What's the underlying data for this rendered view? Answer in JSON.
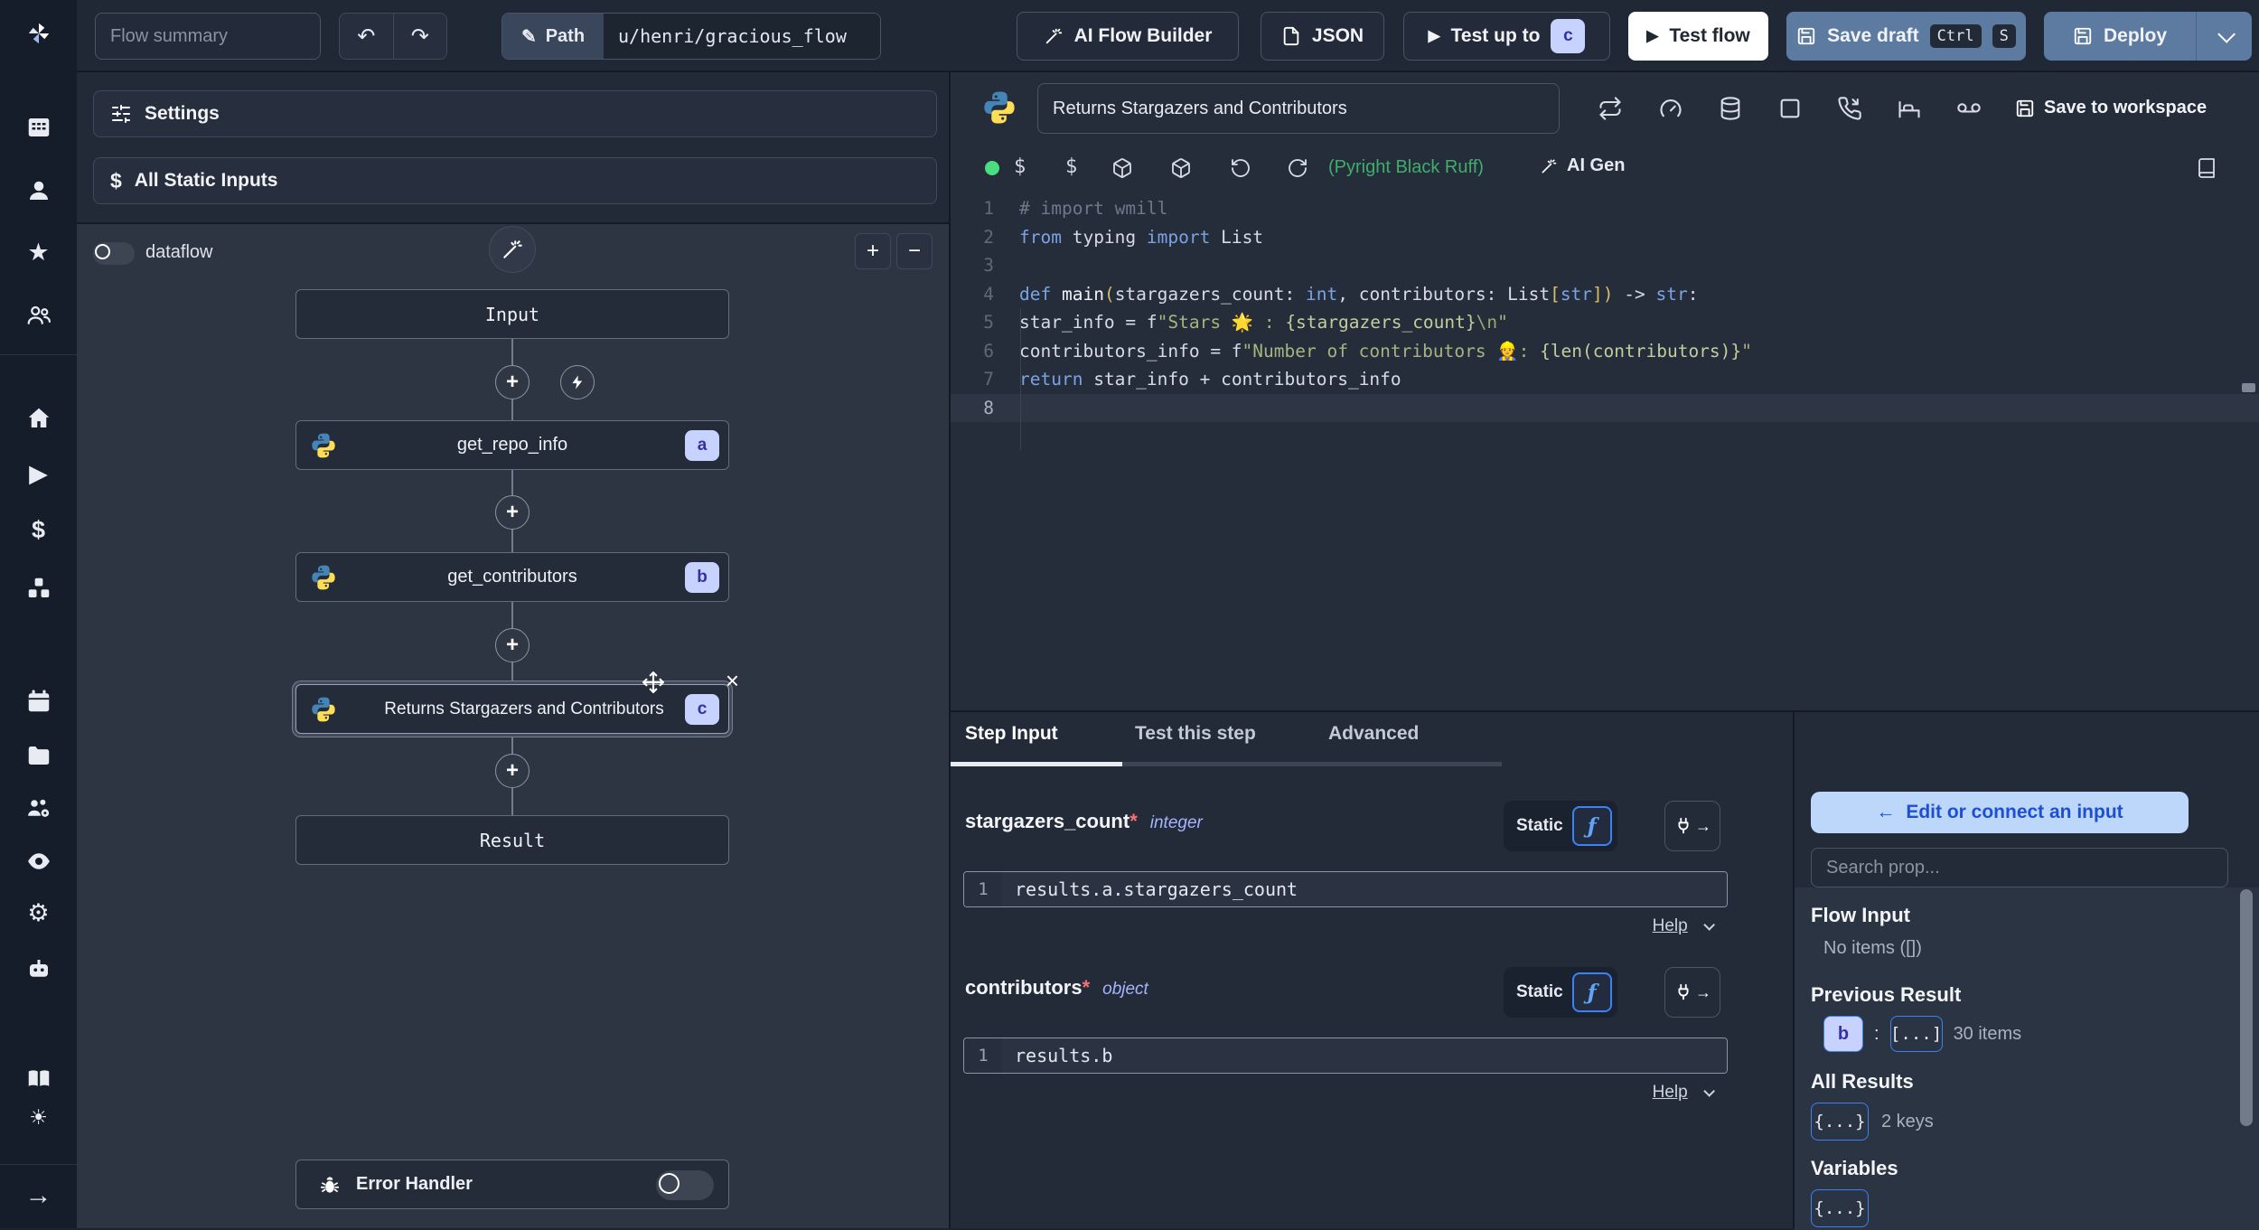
{
  "icons": {
    "undo": "↶",
    "redo": "↷",
    "pencil": "✎",
    "play": "▶",
    "plus": "+",
    "minus": "−",
    "node_plus": "+",
    "close": "×",
    "dollar": "$",
    "star": "★",
    "gear": "⚙",
    "sun": "☀",
    "arrow_right": "→",
    "back_arrow": "←",
    "colon": ":"
  },
  "header": {
    "flow_summary_placeholder": "Flow summary",
    "path_label": "Path",
    "path_value": "u/henri/gracious_flow",
    "ai_flow_builder": "AI Flow Builder",
    "json": "JSON",
    "test_up_to": "Test up to",
    "test_up_to_badge": "c",
    "test_flow": "Test flow",
    "save_draft": "Save draft",
    "save_draft_kbd1": "Ctrl",
    "save_draft_kbd2": "S",
    "deploy": "Deploy"
  },
  "left_panel": {
    "settings": "Settings",
    "all_static_inputs": "All Static Inputs",
    "dataflow": "dataflow",
    "nodes": {
      "input": "Input",
      "a_label": "get_repo_info",
      "a_badge": "a",
      "b_label": "get_contributors",
      "b_badge": "b",
      "c_label": "Returns Stargazers and Contributors",
      "c_badge": "c",
      "result": "Result",
      "error_handler": "Error Handler"
    }
  },
  "editor": {
    "step_name": "Returns Stargazers and Contributors",
    "save_to_workspace": "Save to workspace",
    "lint": "(Pyright Black Ruff)",
    "ai_gen": "AI Gen",
    "code_lines": [
      {
        "tokens": [
          [
            "cmt",
            "# import wmill"
          ]
        ]
      },
      {
        "tokens": [
          [
            "kw",
            "from"
          ],
          [
            "pl",
            " typing "
          ],
          [
            "kw",
            "import"
          ],
          [
            "pl",
            " List"
          ]
        ]
      },
      {
        "tokens": []
      },
      {
        "tokens": [
          [
            "kw",
            "def"
          ],
          [
            "fn",
            " main"
          ],
          [
            "br",
            "("
          ],
          [
            "pl",
            "stargazers_count: "
          ],
          [
            "ty",
            "int"
          ],
          [
            "pl",
            ", contributors: "
          ],
          [
            "pl",
            "List"
          ],
          [
            "br",
            "["
          ],
          [
            "ty",
            "str"
          ],
          [
            "br",
            "]"
          ],
          [
            "br",
            ")"
          ],
          [
            "pl",
            " -> "
          ],
          [
            "ty",
            "str"
          ],
          [
            "pl",
            ":"
          ]
        ]
      },
      {
        "tokens": [
          [
            "pl",
            "    star_info = f"
          ],
          [
            "str",
            "\"Stars 🌟 : "
          ],
          [
            "strb",
            "{stargazers_count}"
          ],
          [
            "esc",
            "\\n"
          ],
          [
            "str",
            "\""
          ]
        ]
      },
      {
        "tokens": [
          [
            "pl",
            "    contributors_info = f"
          ],
          [
            "str",
            "\"Number of contributors 👷: "
          ],
          [
            "strb",
            "{len(contributors)}"
          ],
          [
            "str",
            "\""
          ]
        ]
      },
      {
        "tokens": [
          [
            "pl",
            "    "
          ],
          [
            "kw",
            "return"
          ],
          [
            "pl",
            " star_info + contributors_info"
          ]
        ]
      },
      {
        "tokens": [],
        "active": true
      }
    ]
  },
  "bottom": {
    "tabs": [
      "Step Input",
      "Test this step",
      "Advanced"
    ],
    "fields": [
      {
        "name": "stargazers_count",
        "required": "*",
        "type": "integer",
        "toggle_static": "Static",
        "fn_icon": "ƒ",
        "line": "1",
        "value": "results.a.stargazers_count",
        "help": "Help"
      },
      {
        "name": "contributors",
        "required": "*",
        "type": "object",
        "toggle_static": "Static",
        "fn_icon": "ƒ",
        "line": "1",
        "value": "results.b",
        "help": "Help"
      }
    ]
  },
  "connect": {
    "back": "Edit or connect an input",
    "search_placeholder": "Search prop...",
    "flow_input_title": "Flow Input",
    "flow_input_empty": "No items ([])",
    "previous_result_title": "Previous Result",
    "prev_key": "b",
    "prev_badge": "[...]",
    "prev_count": "30 items",
    "all_results_title": "All Results",
    "all_badge": "{...}",
    "all_count": "2 keys",
    "variables_title": "Variables",
    "variables_badge": "{...}"
  },
  "colors": {
    "accent_lavender": "#c7d2fe",
    "accent_blue": "#3b82f6",
    "lint_green": "#3fae6a",
    "steel_button": "#5d7aa0"
  }
}
